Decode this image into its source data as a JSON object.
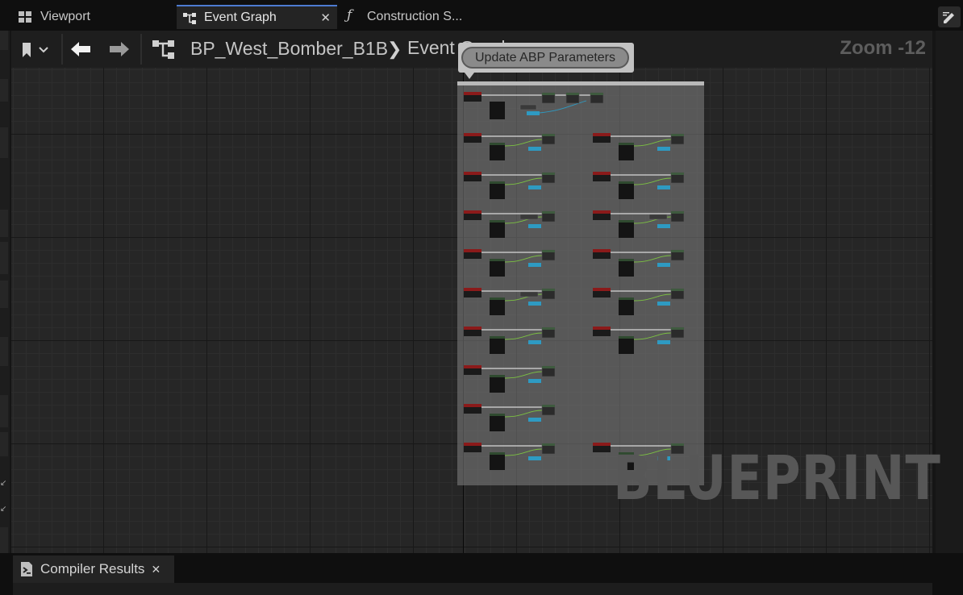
{
  "tabs": [
    {
      "label": "Viewport",
      "icon": "viewport-grid-icon",
      "active": false
    },
    {
      "label": "Event Graph",
      "icon": "event-graph-icon",
      "active": true
    },
    {
      "label": "Construction S...",
      "icon": "function-icon",
      "active": false
    }
  ],
  "toolbar": {
    "breadcrumb_root": "BP_West_Bomber_B1B",
    "breadcrumb_current": "Event Graph",
    "zoom": "Zoom -12"
  },
  "graph": {
    "comment_title": "Update ABP Parameters",
    "watermark": "BLUEPRINT"
  },
  "bottom_panel": {
    "tab_label": "Compiler Results"
  },
  "colors": {
    "accent": "#4d7bd1",
    "event_node": "#8b1a1a",
    "exec_wire": "#ffffff",
    "float_wire": "#7cc242",
    "struct_wire": "#2e9ac2"
  }
}
